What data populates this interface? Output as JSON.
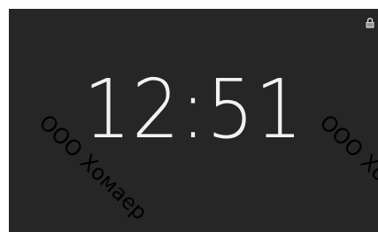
{
  "lockscreen": {
    "time": "12:51",
    "status_icon": "lock-icon",
    "background_color": "#262626",
    "text_color": "#f2f2f2"
  },
  "watermark": {
    "text": "ООО Хомаер"
  }
}
